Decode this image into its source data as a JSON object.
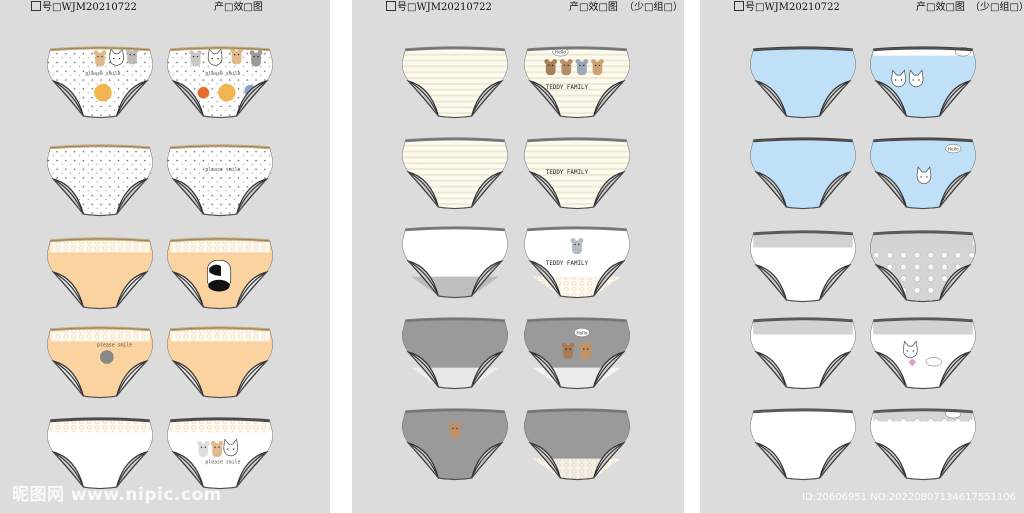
{
  "header": {
    "left_code": "号□WJM20210722",
    "title": "产□效□图",
    "group_note": "（少□组□）"
  },
  "prints": {
    "please_smile": "please smile",
    "teddy_family": "TEDDY FAMILY",
    "hello": "Hello"
  },
  "colors": {
    "cream": "#fbf6e3",
    "peach": "#fbd3a0",
    "white": "#ffffff",
    "sky": "#bfe0f7",
    "gray_light": "#d2d2d2",
    "gray_mid": "#9a9a9a",
    "waist_gray": "#7d7d7d",
    "waist_brown": "#c8a872"
  },
  "watermark": {
    "site": "昵图网 www.nipic.com",
    "id_text": "ID:20606951 NO:20220807134617551106"
  }
}
